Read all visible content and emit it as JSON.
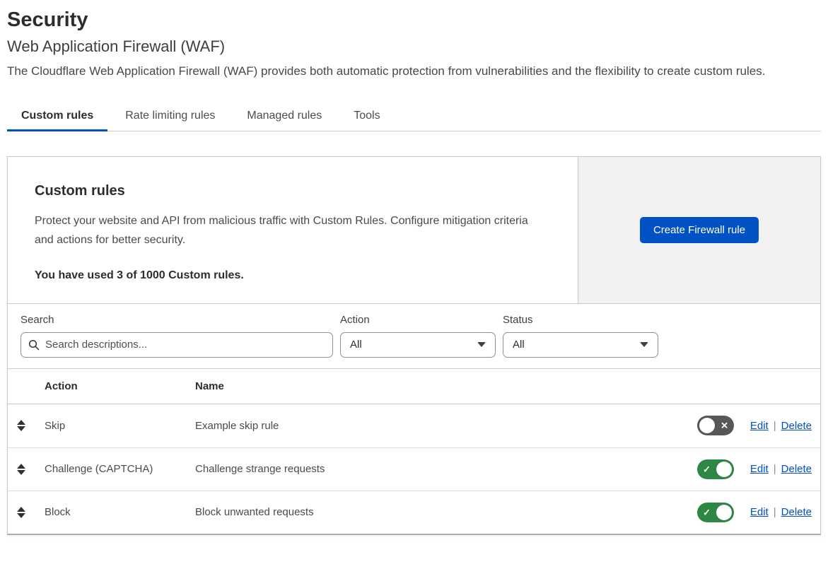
{
  "page": {
    "title": "Security",
    "subtitle": "Web Application Firewall (WAF)",
    "description": "The Cloudflare Web Application Firewall (WAF) provides both automatic protection from vulnerabilities and the flexibility to create custom rules."
  },
  "tabs": [
    {
      "label": "Custom rules",
      "active": true
    },
    {
      "label": "Rate limiting rules",
      "active": false
    },
    {
      "label": "Managed rules",
      "active": false
    },
    {
      "label": "Tools",
      "active": false
    }
  ],
  "card": {
    "heading": "Custom rules",
    "description": "Protect your website and API from malicious traffic with Custom Rules. Configure mitigation criteria and actions for better security.",
    "usage": "You have used 3 of 1000 Custom rules.",
    "create_button_label": "Create Firewall rule"
  },
  "filters": {
    "search_label": "Search",
    "search_placeholder": "Search descriptions...",
    "search_value": "",
    "action_label": "Action",
    "action_value": "All",
    "status_label": "Status",
    "status_value": "All"
  },
  "table": {
    "columns": {
      "action": "Action",
      "name": "Name"
    },
    "edit_label": "Edit",
    "delete_label": "Delete",
    "link_separator": "|",
    "rows": [
      {
        "action": "Skip",
        "name": "Example skip rule",
        "enabled": false
      },
      {
        "action": "Challenge (CAPTCHA)",
        "name": "Challenge strange requests",
        "enabled": true
      },
      {
        "action": "Block",
        "name": "Block unwanted requests",
        "enabled": true
      }
    ]
  },
  "icons": {
    "search": "search-icon",
    "dropdown_caret": "chevron-down-icon",
    "drag_handle": "drag-reorder-icon",
    "toggle_on_glyph": "✓",
    "toggle_off_glyph": "✕"
  },
  "colors": {
    "accent_blue": "#0051c3",
    "toggle_on_green": "#2e8745",
    "toggle_off_gray": "#575757",
    "side_panel_gray": "#f1f1f1"
  }
}
